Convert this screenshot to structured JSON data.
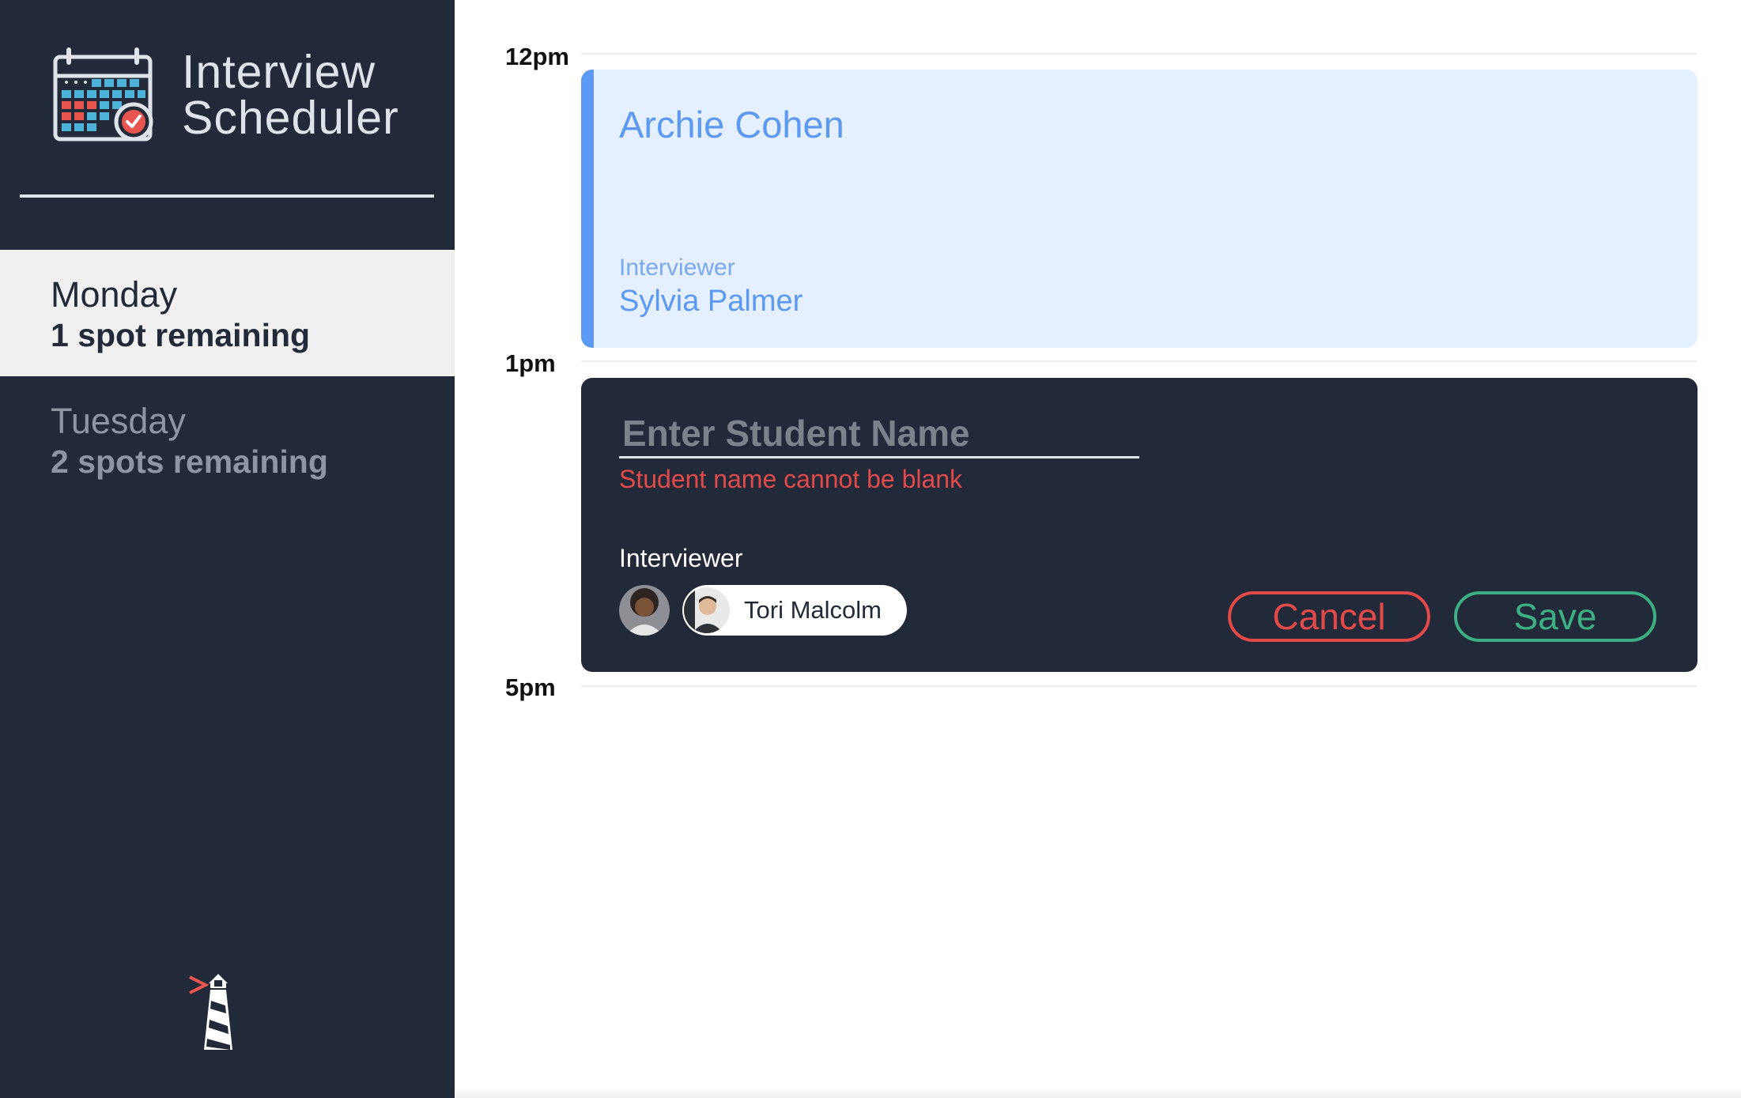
{
  "app": {
    "title_line1": "Interview",
    "title_line2": "Scheduler",
    "logo_icon": "calendar-check-icon",
    "footer_icon": "lighthouse-icon"
  },
  "days": [
    {
      "name": "Monday",
      "spots": "1 spot remaining",
      "selected": true
    },
    {
      "name": "Tuesday",
      "spots": "2 spots remaining",
      "selected": false
    }
  ],
  "schedule": {
    "times": [
      "12pm",
      "1pm",
      "5pm"
    ],
    "booked": {
      "student": "Archie Cohen",
      "interviewer_label": "Interviewer",
      "interviewer": "Sylvia Palmer"
    },
    "form": {
      "student_value": "",
      "student_placeholder": "Enter Student Name",
      "validation_error": "Student name cannot be blank",
      "interviewer_heading": "Interviewer",
      "interviewers": [
        {
          "name": "",
          "selected": false,
          "icon": "interviewer-avatar-icon"
        },
        {
          "name": "Tori Malcolm",
          "selected": true,
          "icon": "interviewer-avatar-icon"
        }
      ],
      "cancel_label": "Cancel",
      "save_label": "Save"
    }
  },
  "colors": {
    "sidebar_bg": "#222a3a",
    "selected_day_bg": "#f0f0f0",
    "booked_accent": "#5c99f3",
    "booked_bg": "#e4efff",
    "danger": "#e24a4a",
    "success": "#3cb083"
  }
}
